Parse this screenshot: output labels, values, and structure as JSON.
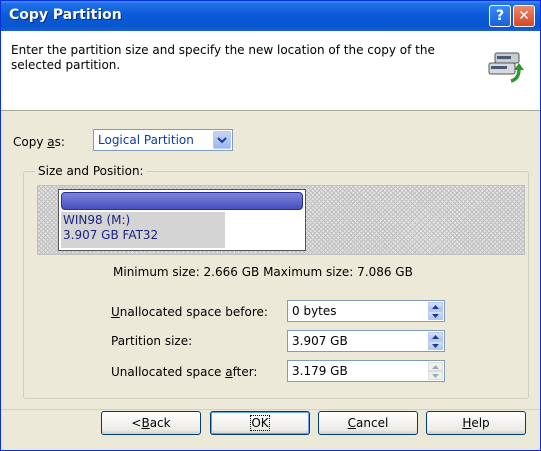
{
  "window": {
    "title": "Copy Partition"
  },
  "titlebar": {
    "help_glyph": "?",
    "close_glyph": "✕"
  },
  "header": {
    "description": "Enter the partition size and specify the new location of the copy of the selected partition.",
    "icon": "copy-disk-icon"
  },
  "copy_as": {
    "label_pre": "Copy ",
    "label_key": "a",
    "label_post": "s:",
    "value": "Logical Partition"
  },
  "group": {
    "label": "Size and Position:"
  },
  "partition": {
    "name": "WIN98 (M:)",
    "info": "3.907 GB  FAT32"
  },
  "sizes": {
    "text": "Minimum size: 2.666 GB  Maximum size: 7.086 GB"
  },
  "fields": [
    {
      "label_key": "U",
      "label_rest": "nallocated space before:",
      "value": "0 bytes"
    },
    {
      "label_key": "",
      "label_rest": "Partition size:",
      "value": "3.907 GB"
    },
    {
      "label_pre": "Unallocated space ",
      "label_key": "a",
      "label_rest": "fter:",
      "value": "3.179 GB"
    }
  ],
  "buttons": {
    "back": {
      "pre": "< ",
      "key": "B",
      "post": "ack"
    },
    "ok": {
      "label": "OK"
    },
    "cancel": {
      "key": "C",
      "post": "ancel"
    },
    "help": {
      "key": "H",
      "post": "elp"
    }
  },
  "colors": {
    "title_bar": "#0a5ad8",
    "dialog_bg": "#ece9d8",
    "partition_bar": "#4850c0",
    "close_button": "#d5462a"
  }
}
